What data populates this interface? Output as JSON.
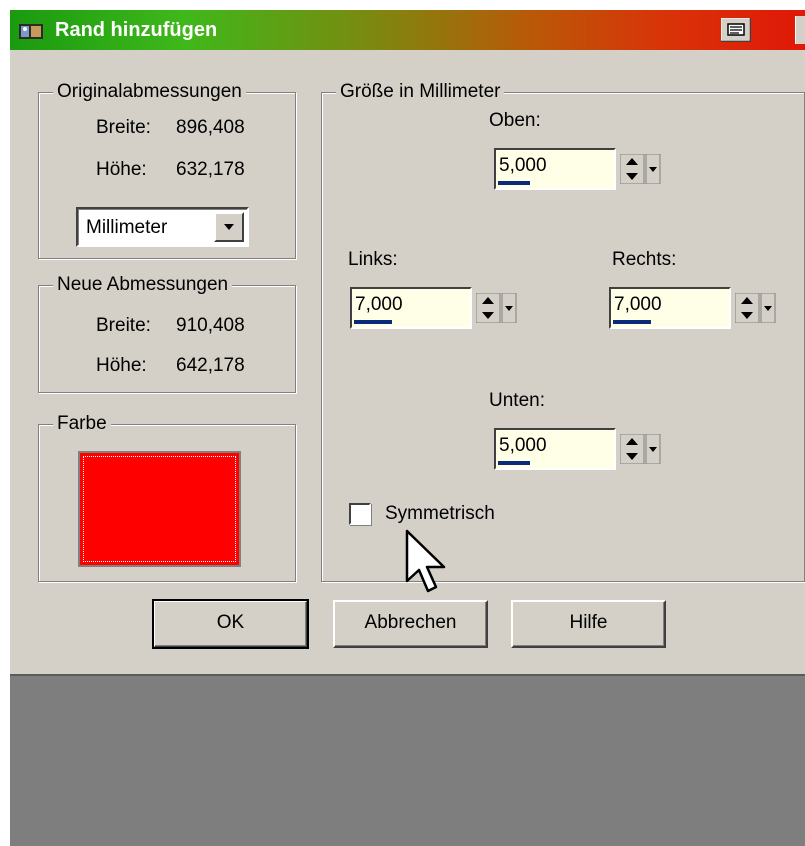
{
  "window": {
    "title": "Rand hinzufügen",
    "icon": "app-icon",
    "colors": {
      "titlebar_start": "#1a9a10",
      "titlebar_end": "#e01808",
      "face": "#d4d0c8",
      "desktop": "#7e7e7e"
    }
  },
  "original": {
    "legend": "Originalabmessungen",
    "width_label": "Breite:",
    "width_value": "896,408",
    "height_label": "Höhe:",
    "height_value": "632,178",
    "unit_select": "Millimeter"
  },
  "new": {
    "legend": "Neue Abmessungen",
    "width_label": "Breite:",
    "width_value": "910,408",
    "height_label": "Höhe:",
    "height_value": "642,178"
  },
  "color": {
    "legend": "Farbe",
    "value": "#ff0000"
  },
  "size": {
    "legend": "Größe in Millimeter",
    "top_label": "Oben:",
    "top_value": "5,000",
    "left_label": "Links:",
    "left_value": "7,000",
    "right_label": "Rechts:",
    "right_value": "7,000",
    "bottom_label": "Unten:",
    "bottom_value": "5,000",
    "symmetric_label": "Symmetrisch",
    "symmetric_checked": false
  },
  "buttons": {
    "ok": "OK",
    "cancel": "Abbrechen",
    "help": "Hilfe"
  }
}
